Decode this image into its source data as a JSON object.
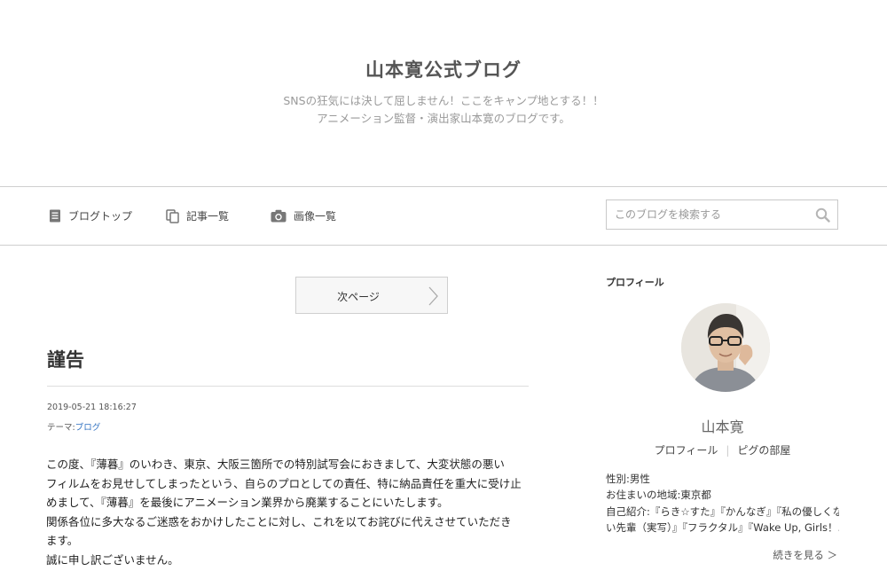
{
  "header": {
    "title": "山本寛公式ブログ",
    "description_line1": "SNSの狂気には決して屈しません！ここをキャンプ地とする！！",
    "description_line2": "アニメーション監督・演出家山本寛のブログです。"
  },
  "nav": {
    "items": [
      {
        "label": "ブログトップ",
        "icon": "document-list-icon"
      },
      {
        "label": "記事一覧",
        "icon": "copy-pages-icon"
      },
      {
        "label": "画像一覧",
        "icon": "camera-icon"
      }
    ],
    "search_placeholder": "このブログを検索する"
  },
  "pager": {
    "next_label": "次ページ"
  },
  "entry": {
    "title": "謹告",
    "date": "2019-05-21 18:16:27",
    "theme_prefix": "テーマ:",
    "theme": "ブログ",
    "body_lines": [
      "この度、『薄暮』のいわき、東京、大阪三箇所での特別試写会におきまして、大変状態の悪い",
      "フィルムをお見せしてしまったという、自らのプロとしての責任、特に納品責任を重大に受け止",
      "めまして、『薄暮』を最後にアニメーション業界から廃業することにいたします。",
      "関係各位に多大なるご迷惑をおかけしたことに対し、これを以てお詫びに代えさせていただき",
      "ます。",
      "誠に申し訳ございません。"
    ]
  },
  "sidebar": {
    "heading": "プロフィール",
    "name": "山本寛",
    "links": [
      "プロフィール",
      "ピグの部屋"
    ],
    "info": [
      "性別:男性",
      "お住まいの地域:東京都",
      "自己紹介:『らき☆すた』『かんなぎ』『私の優しくな",
      "い先輩（実写）』『フラクタル』『Wake Up, Girls！..."
    ],
    "more_label": "続きを見る ＞"
  }
}
